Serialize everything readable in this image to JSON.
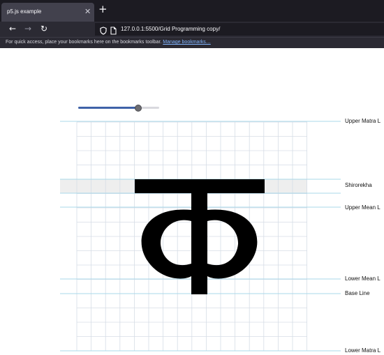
{
  "browser": {
    "tab_title": "p5.js example",
    "tab_close_glyph": "✕",
    "new_tab_glyph": "+",
    "back_glyph": "←",
    "forward_glyph": "→",
    "reload_glyph": "↻",
    "url": "127.0.0.1:5500/Grid Programming copy/",
    "bookmarks_message": "For quick access, place your bookmarks here on the bookmarks toolbar.",
    "bookmarks_link": "Manage bookmarks…"
  },
  "slider": {
    "value_fraction": 0.74
  },
  "guides": {
    "upper_matra": "Upper Matra L",
    "shirorekha": "Shirorekha",
    "upper_mean": "Upper Mean L",
    "lower_mean": "Lower Mean L",
    "base_line": "Base Line",
    "lower_matra": "Lower Matra L"
  },
  "colors": {
    "guide_line": "#a8d8ea",
    "grid_line": "#d6dde6",
    "band_fill": "#eeeeee",
    "glyph": "#000000"
  }
}
